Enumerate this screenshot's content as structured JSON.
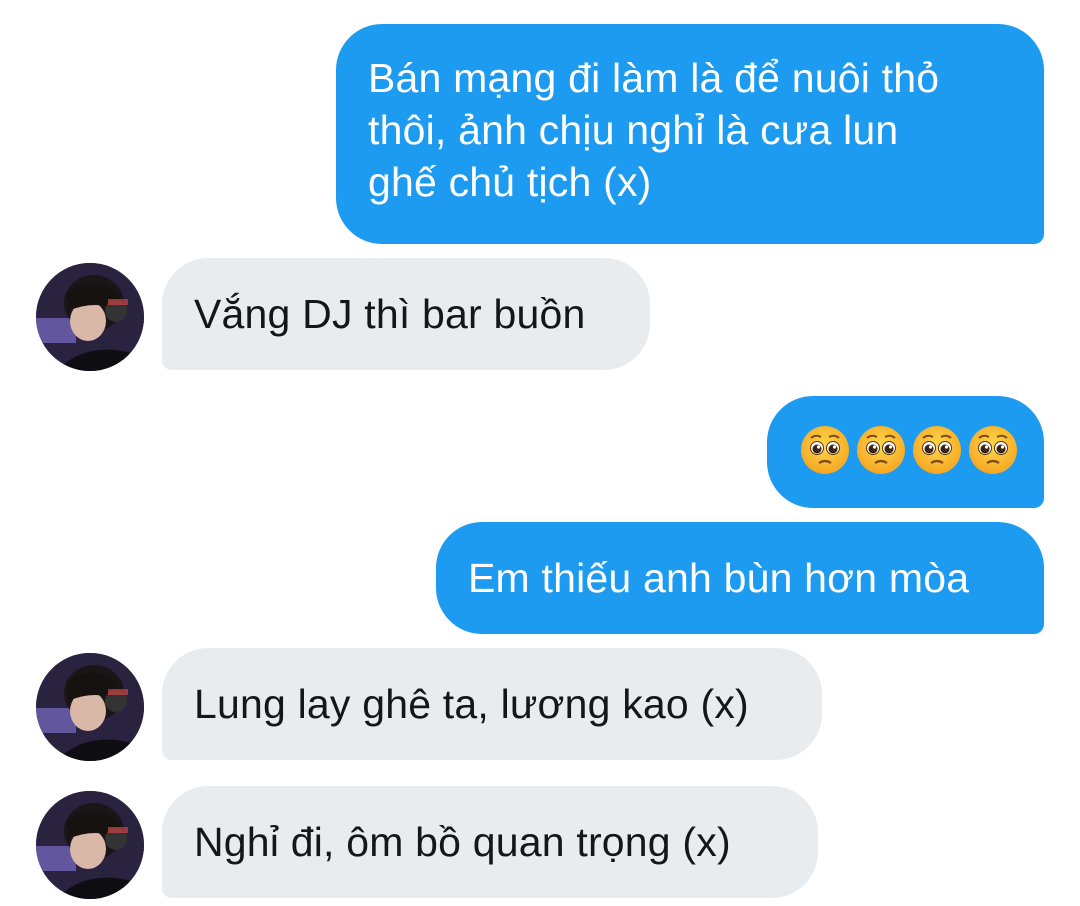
{
  "messages": {
    "m1": {
      "lines": [
        "Bán mạng đi làm là để nuôi thỏ",
        "thôi, ảnh chịu nghỉ là cưa lun",
        "ghế chủ tịch (x)"
      ]
    },
    "m2": {
      "text": "Vắng DJ thì bar buồn"
    },
    "m3": {
      "emojis": [
        "pleading-face-emoji",
        "pleading-face-emoji",
        "pleading-face-emoji",
        "pleading-face-emoji"
      ]
    },
    "m4": {
      "text": "Em thiếu anh bùn hơn mòa"
    },
    "m5": {
      "text": "Lung lay ghê ta, lương kao (x)"
    },
    "m6": {
      "text": "Nghỉ đi, ôm bồ quan trọng (x)"
    }
  },
  "colors": {
    "outgoing_bubble": "#1d9bf0",
    "incoming_bubble": "#e9ecef",
    "incoming_text": "#14171a",
    "background": "#ffffff"
  }
}
